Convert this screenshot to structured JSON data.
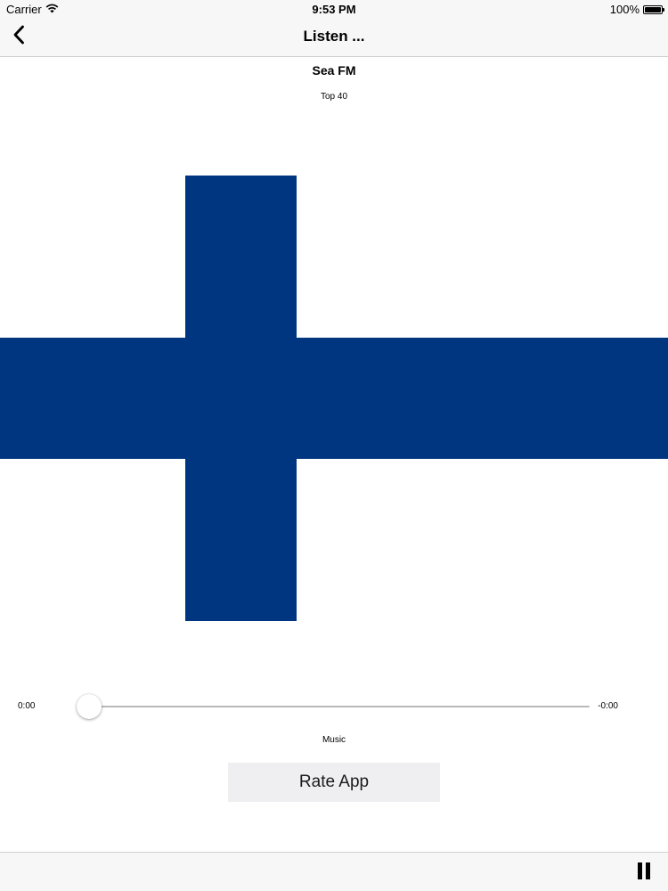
{
  "status_bar": {
    "carrier": "Carrier",
    "wifi_icon": "wifi-icon",
    "time": "9:53 PM",
    "battery_text": "100%",
    "battery_icon": "battery-icon",
    "battery_level": 1.0
  },
  "nav": {
    "back_icon": "chevron-left-icon",
    "title": "Listen ..."
  },
  "station": {
    "name": "Sea FM",
    "genre": "Top 40"
  },
  "flag": {
    "background_color": "#ffffff",
    "cross_color": "#003580"
  },
  "player": {
    "elapsed": "0:00",
    "remaining": "-0:00",
    "progress": 0,
    "label": "Music"
  },
  "actions": {
    "rate_label": "Rate App"
  },
  "toolbar": {
    "pause_icon": "pause-icon"
  },
  "colors": {
    "bar_background": "#f7f7f8",
    "button_background": "#efeff1",
    "track": "#b9b9bd"
  }
}
